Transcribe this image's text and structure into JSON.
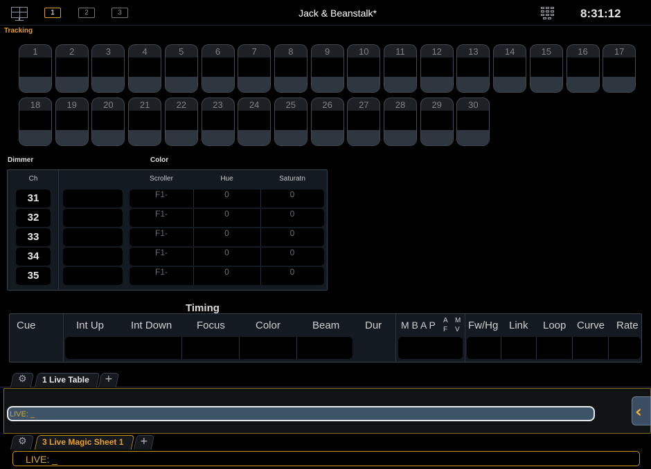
{
  "header": {
    "pages": [
      "1",
      "2",
      "3"
    ],
    "show_title": "Jack & Beanstalk*",
    "clock": "8:31:12"
  },
  "tracking": {
    "label": "Tracking",
    "channels": [
      "1",
      "2",
      "3",
      "4",
      "5",
      "6",
      "7",
      "8",
      "9",
      "10",
      "11",
      "12",
      "13",
      "14",
      "15",
      "16",
      "17",
      "18",
      "19",
      "20",
      "21",
      "22",
      "23",
      "24",
      "25",
      "26",
      "27",
      "28",
      "29",
      "30"
    ]
  },
  "channel_table": {
    "dimmer_label": "Dimmer",
    "color_label": "Color",
    "headers": {
      "ch": "Ch",
      "scroller": "Scroller",
      "hue": "Hue",
      "saturation": "Saturatn"
    },
    "rows": [
      {
        "ch": "31",
        "scroller": "F1-",
        "hue": "0",
        "saturation": "0"
      },
      {
        "ch": "32",
        "scroller": "F1-",
        "hue": "0",
        "saturation": "0"
      },
      {
        "ch": "33",
        "scroller": "F1-",
        "hue": "0",
        "saturation": "0"
      },
      {
        "ch": "34",
        "scroller": "F1-",
        "hue": "0",
        "saturation": "0"
      },
      {
        "ch": "35",
        "scroller": "F1-",
        "hue": "0",
        "saturation": "0"
      }
    ]
  },
  "timing": {
    "label": "Timing",
    "headers": {
      "cue": "Cue",
      "int_up": "Int Up",
      "int_down": "Int Down",
      "focus": "Focus",
      "color": "Color",
      "beam": "Beam",
      "dur": "Dur",
      "mbap": "M B A P",
      "af": "A F",
      "mv": "M V",
      "fwhg": "Fw/Hg",
      "link": "Link",
      "loop": "Loop",
      "curve": "Curve",
      "rate": "Rate"
    }
  },
  "tabs_top": {
    "tab_label": "1 Live Table",
    "add": "+"
  },
  "command_line": {
    "text": "LIVE: _"
  },
  "tabs_bottom": {
    "tab_label": "3 Live Magic Sheet 1",
    "add": "+"
  },
  "command_line_2": {
    "text": "LIVE:  _"
  },
  "colors": {
    "accent": "#e7a12b",
    "panel": "#131a22",
    "command_bar": "#3e5365"
  }
}
